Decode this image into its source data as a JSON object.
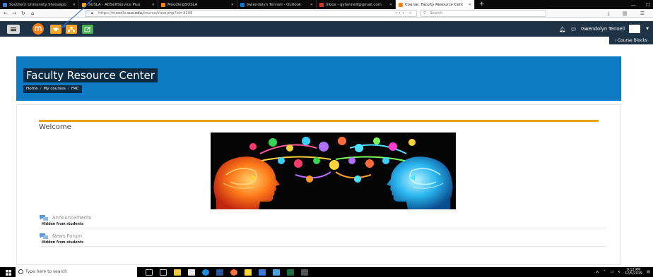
{
  "browser": {
    "tabs": [
      {
        "label": "Southern University Shrevepo",
        "favicon_color": "#3a7bd5"
      },
      {
        "label": "SUSLA - ADSelfService Plus",
        "favicon_color": "#f2a516"
      },
      {
        "label": "Moodle@SUSLA",
        "favicon_color": "#f98012"
      },
      {
        "label": "Gwendolyn Tennell - Outlook",
        "favicon_color": "#0078d4"
      },
      {
        "label": "Inbox - gytennell@gmail.com",
        "favicon_color": "#d93025"
      },
      {
        "label": "Course: Faculty Resource Cent",
        "favicon_color": "#f98012"
      }
    ],
    "active_tab_index": 5,
    "new_tab": "+",
    "url_prefix": "https://moodle.",
    "url_domain": "sus.edu",
    "url_suffix": "/course/view.php?id=3208",
    "page_actions": "••• ☆",
    "search_placeholder": "Search",
    "window_controls": [
      "—",
      "☐",
      "✕"
    ]
  },
  "moodle_bar": {
    "user_name": "Gwendolyn Tennell",
    "course_blocks_label": "Course Blocks"
  },
  "header": {
    "title": "Faculty Resource Center",
    "breadcrumb": [
      "Home",
      "My courses",
      "FRC"
    ]
  },
  "main": {
    "welcome": "Welcome",
    "activities": [
      {
        "name": "Announcements",
        "note": "Hidden from students"
      },
      {
        "name": "News Forum",
        "note": "Hidden from students"
      }
    ]
  },
  "taskbar": {
    "search_placeholder": "Type here to search",
    "time": "9:12 PM",
    "date": "12/5/2019"
  },
  "colors": {
    "moodle_navy": "#1f3347",
    "header_blue": "#0e7cc4",
    "gold_line": "#e8a317",
    "button_orange": "#f5a623",
    "button_green": "#4caf50"
  }
}
